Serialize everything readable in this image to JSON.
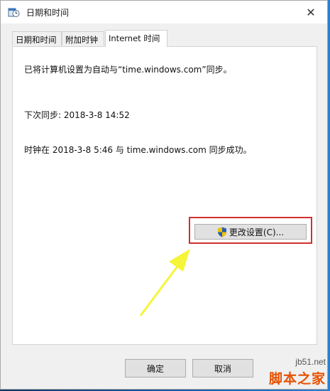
{
  "window": {
    "title": "日期和时间",
    "close_glyph": "✕"
  },
  "tabs": [
    {
      "label": "日期和时间",
      "active": false
    },
    {
      "label": "附加时钟",
      "active": false
    },
    {
      "label": "Internet 时间",
      "active": true
    }
  ],
  "panel": {
    "sync_description": "已将计算机设置为自动与“time.windows.com”同步。",
    "next_sync": "下次同步: 2018-3-8 14:52",
    "last_sync_status": "时钟在 2018-3-8 5:46 与 time.windows.com 同步成功。",
    "change_settings_button": "更改设置(C)..."
  },
  "footer": {
    "ok_button": "确定",
    "cancel_button": "取消"
  },
  "watermark": {
    "url": "jb51.net",
    "text": "脚本之家"
  },
  "colors": {
    "highlight_box": "#d32f2f",
    "arrow": "#f5f53a"
  }
}
